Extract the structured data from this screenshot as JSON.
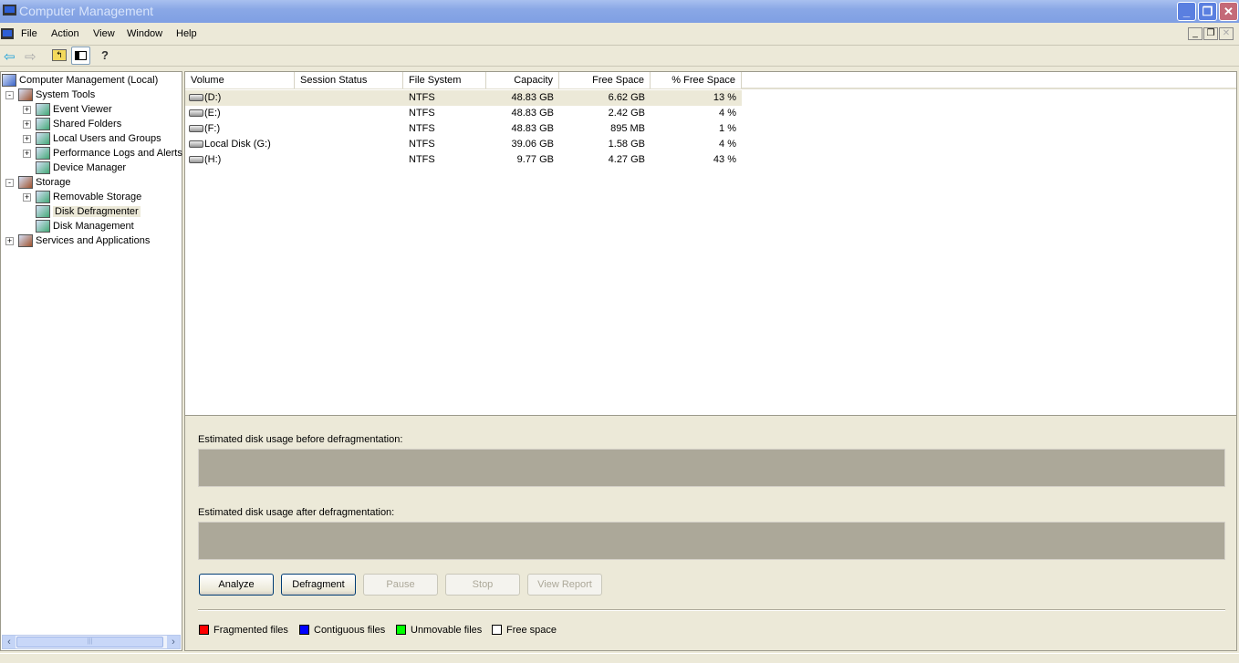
{
  "window": {
    "title": "Computer Management"
  },
  "menu": [
    "File",
    "Action",
    "View",
    "Window",
    "Help"
  ],
  "tree": [
    {
      "label": "Computer Management (Local)",
      "level": 0,
      "exp": ""
    },
    {
      "label": "System Tools",
      "level": 1,
      "exp": "−"
    },
    {
      "label": "Event Viewer",
      "level": 2,
      "exp": "+"
    },
    {
      "label": "Shared Folders",
      "level": 2,
      "exp": "+"
    },
    {
      "label": "Local Users and Groups",
      "level": 2,
      "exp": "+"
    },
    {
      "label": "Performance Logs and Alerts",
      "level": 2,
      "exp": "+"
    },
    {
      "label": "Device Manager",
      "level": 2,
      "exp": ""
    },
    {
      "label": "Storage",
      "level": 1,
      "exp": "−"
    },
    {
      "label": "Removable Storage",
      "level": 2,
      "exp": "+"
    },
    {
      "label": "Disk Defragmenter",
      "level": 2,
      "exp": "",
      "selected": true
    },
    {
      "label": "Disk Management",
      "level": 2,
      "exp": ""
    },
    {
      "label": "Services and Applications",
      "level": 1,
      "exp": "+"
    }
  ],
  "columns": [
    "Volume",
    "Session Status",
    "File System",
    "Capacity",
    "Free Space",
    "% Free Space"
  ],
  "volumes": [
    {
      "volume": "(D:)",
      "status": "",
      "fs": "NTFS",
      "capacity": "48.83 GB",
      "free": "6.62 GB",
      "pct": "13 %"
    },
    {
      "volume": "(E:)",
      "status": "",
      "fs": "NTFS",
      "capacity": "48.83 GB",
      "free": "2.42 GB",
      "pct": "4 %"
    },
    {
      "volume": "(F:)",
      "status": "",
      "fs": "NTFS",
      "capacity": "48.83 GB",
      "free": "895 MB",
      "pct": "1 %"
    },
    {
      "volume": "Local Disk (G:)",
      "status": "",
      "fs": "NTFS",
      "capacity": "39.06 GB",
      "free": "1.58 GB",
      "pct": "4 %"
    },
    {
      "volume": "(H:)",
      "status": "",
      "fs": "NTFS",
      "capacity": "9.77 GB",
      "free": "4.27 GB",
      "pct": "43 %"
    }
  ],
  "defrag": {
    "before_label": "Estimated disk usage before defragmentation:",
    "after_label": "Estimated disk usage after defragmentation:",
    "buttons": [
      {
        "label": "Analyze",
        "enabled": true
      },
      {
        "label": "Defragment",
        "enabled": true
      },
      {
        "label": "Pause",
        "enabled": false
      },
      {
        "label": "Stop",
        "enabled": false
      },
      {
        "label": "View Report",
        "enabled": false
      }
    ],
    "legend": [
      {
        "label": "Fragmented files",
        "color": "#ff0000"
      },
      {
        "label": "Contiguous files",
        "color": "#0000ff"
      },
      {
        "label": "Unmovable files",
        "color": "#00ff00"
      },
      {
        "label": "Free space",
        "color": "#ffffff"
      }
    ]
  }
}
